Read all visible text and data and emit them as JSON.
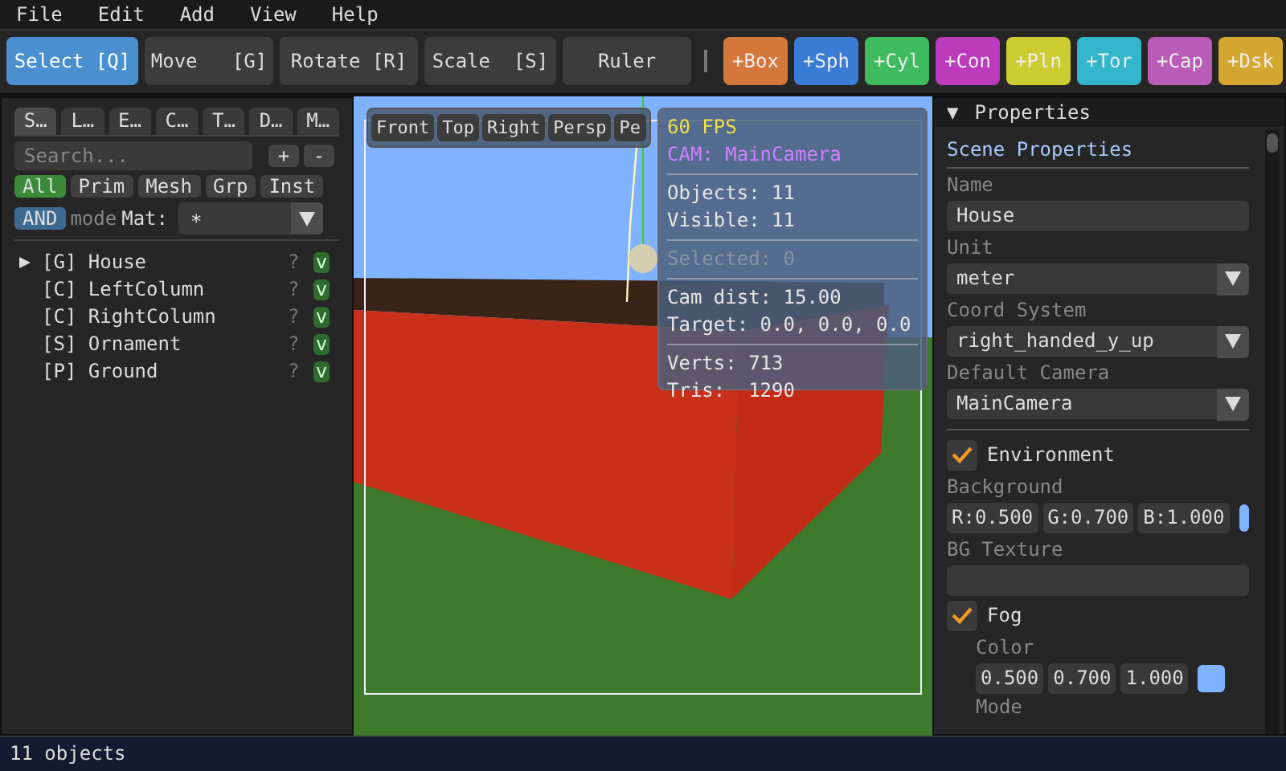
{
  "menu": [
    "File",
    "Edit",
    "Add",
    "View",
    "Help"
  ],
  "tools": [
    {
      "label": "Select [Q]",
      "selected": true
    },
    {
      "label": "Move   [G]",
      "selected": false
    },
    {
      "label": "Rotate [R]",
      "selected": false
    },
    {
      "label": "Scale  [S]",
      "selected": false
    },
    {
      "label": "Ruler",
      "selected": false
    }
  ],
  "add_buttons": [
    {
      "label": "+Box",
      "color": "#d4773a"
    },
    {
      "label": "+Sph",
      "color": "#3a7bd5"
    },
    {
      "label": "+Cyl",
      "color": "#3dbb5e"
    },
    {
      "label": "+Con",
      "color": "#bb3bbb"
    },
    {
      "label": "+Pln",
      "color": "#cccc33"
    },
    {
      "label": "+Tor",
      "color": "#33b5cc"
    },
    {
      "label": "+Cap",
      "color": "#b85cb8"
    },
    {
      "label": "+Dsk",
      "color": "#d4a830"
    }
  ],
  "left_panel": {
    "tabs": [
      {
        "label": "S…",
        "selected": true
      },
      {
        "label": "L…",
        "selected": false
      },
      {
        "label": "E…",
        "selected": false
      },
      {
        "label": "C…",
        "selected": false
      },
      {
        "label": "T…",
        "selected": false
      },
      {
        "label": "D…",
        "selected": false
      },
      {
        "label": "M…",
        "selected": false
      }
    ],
    "search": {
      "placeholder": "Search..."
    },
    "add_button": "+",
    "remove_button": "-",
    "filters": [
      {
        "label": "All",
        "selected": true
      },
      {
        "label": "Prim",
        "selected": false
      },
      {
        "label": "Mesh",
        "selected": false
      },
      {
        "label": "Grp",
        "selected": false
      },
      {
        "label": "Inst",
        "selected": false
      }
    ],
    "logic": "AND",
    "logic_label": "mode",
    "material_label": "Mat:",
    "material_value": "*",
    "tree": [
      {
        "label": "[G] House",
        "expanded": false,
        "info": "?",
        "visible": true,
        "visibility_label": "v"
      },
      {
        "label": "[C] LeftColumn",
        "info": "?",
        "visible": true,
        "visibility_label": "v"
      },
      {
        "label": "[C] RightColumn",
        "info": "?",
        "visible": true,
        "visibility_label": "v"
      },
      {
        "label": "[S] Ornament",
        "info": "?",
        "visible": true,
        "visibility_label": "v"
      },
      {
        "label": "[P] Ground",
        "info": "?",
        "visible": true,
        "visibility_label": "v"
      }
    ]
  },
  "viewport": {
    "view_buttons": [
      "Front",
      "Top",
      "Right",
      "Persp",
      "Pe"
    ],
    "stats": {
      "fps": "60 FPS",
      "camera": "CAM: MainCamera",
      "groups": [
        {
          "lines": [
            "Objects: 11",
            "Visible: 11"
          ],
          "disabled": false
        },
        {
          "lines": [
            "Selected: 0"
          ],
          "disabled": true
        },
        {
          "lines": [
            "Cam dist: 15.00",
            "Target: 0.0, 0.0, 0.0"
          ],
          "disabled": false
        },
        {
          "lines": [
            "Verts: 713",
            "Tris:  1290"
          ],
          "disabled": false
        }
      ]
    }
  },
  "properties": {
    "arrow": "▼",
    "title": "Properties",
    "section_title": "Scene Properties",
    "fields": [
      {
        "label": "Name",
        "value": "House",
        "kind": "text"
      },
      {
        "label": "Unit",
        "value": "meter",
        "kind": "select"
      },
      {
        "label": "Coord System",
        "value": "right_handed_y_up",
        "kind": "select"
      },
      {
        "label": "Default Camera",
        "value": "MainCamera",
        "kind": "select"
      }
    ],
    "environment": {
      "label": "Environment",
      "checked": true,
      "background_label": "Background",
      "components": [
        "R:0.500",
        "G:0.700",
        "B:1.000"
      ],
      "color": "#80b3ff",
      "texture_label": "BG Texture"
    },
    "fog": {
      "label": "Fog",
      "checked": true,
      "color_label": "Color",
      "components": [
        "0.500",
        "0.700",
        "1.000"
      ],
      "color": "#80b3ff",
      "mode_label": "Mode"
    }
  },
  "status_bar": "11 objects"
}
